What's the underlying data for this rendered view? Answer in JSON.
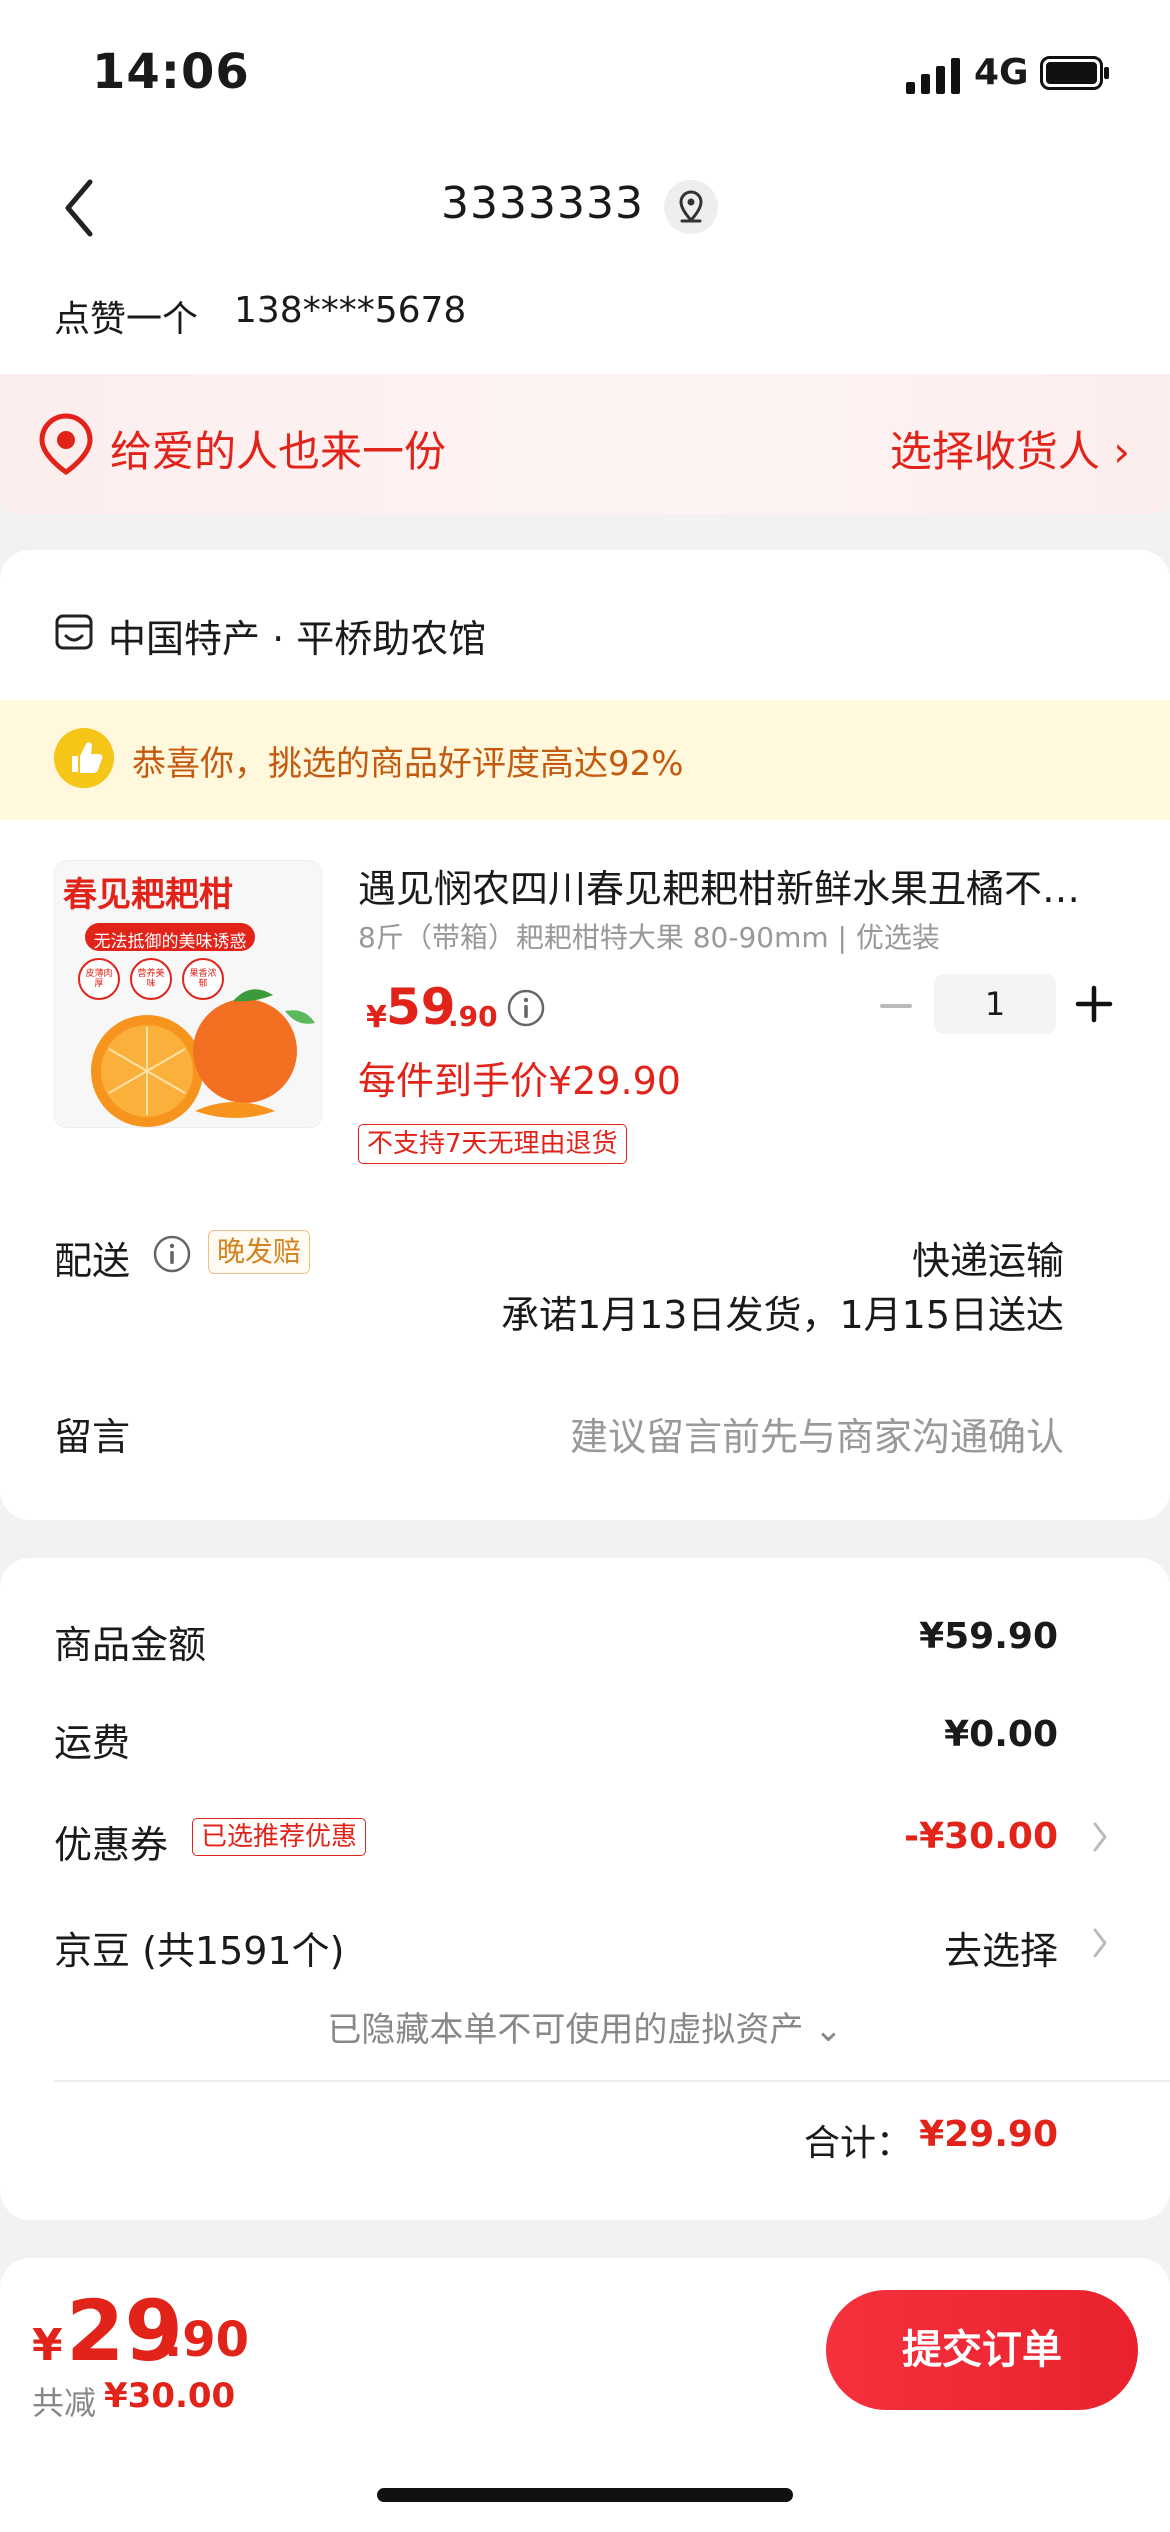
{
  "status": {
    "time": "14:06",
    "network": "4G"
  },
  "header": {
    "recipient_name": "3333333",
    "address_detail": "点赞一个",
    "phone": "138****5678"
  },
  "gift": {
    "text": "给爱的人也来一份",
    "action": "选择收货人 ›"
  },
  "store": {
    "name": "中国特产 · 平桥助农馆",
    "praise": "恭喜你，挑选的商品好评度高达92%"
  },
  "product": {
    "image_title": "春见耙耙柑",
    "image_subtitle": "无法抵御的美味诱惑",
    "image_tags": [
      "皮薄肉厚",
      "营养美味",
      "果香浓郁"
    ],
    "title": "遇见悯农四川春见耙耙柑新鲜水果丑橘不知火当季整箱",
    "spec": "8斤（带箱）耙耙柑特大果 80-90mm | 优选装",
    "price_symbol": "¥",
    "price_int": "59",
    "price_dec": ".90",
    "quantity": "1",
    "unit_price": "每件到手价¥29.90",
    "return_policy": "不支持7天无理由退货"
  },
  "shipping": {
    "label": "配送",
    "badge": "晚发赔",
    "method": "快递运输",
    "promise": "承诺1月13日发货，1月15日送达"
  },
  "message": {
    "label": "留言",
    "placeholder": "建议留言前先与商家沟通确认"
  },
  "summary": {
    "goods_label": "商品金额",
    "goods_value": "¥59.90",
    "freight_label": "运费",
    "freight_value": "¥0.00",
    "coupon_label": "优惠券",
    "coupon_badge": "已选推荐优惠",
    "coupon_value": "-¥30.00",
    "beans_label": "京豆 (共1591个)",
    "beans_action": "去选择",
    "hidden_assets": "已隐藏本单不可使用的虚拟资产 ⌄",
    "total_label": "合计：",
    "total_value": "¥29.90"
  },
  "bottom": {
    "price_symbol": "¥",
    "price_int": "29",
    "price_dec": ".90",
    "saved_label": "共减",
    "saved_value": "¥30.00",
    "submit": "提交订单"
  },
  "colors": {
    "accent": "#e2231a",
    "praise_bg": "#fff8dc",
    "gift_bg": "#fdeeee"
  }
}
